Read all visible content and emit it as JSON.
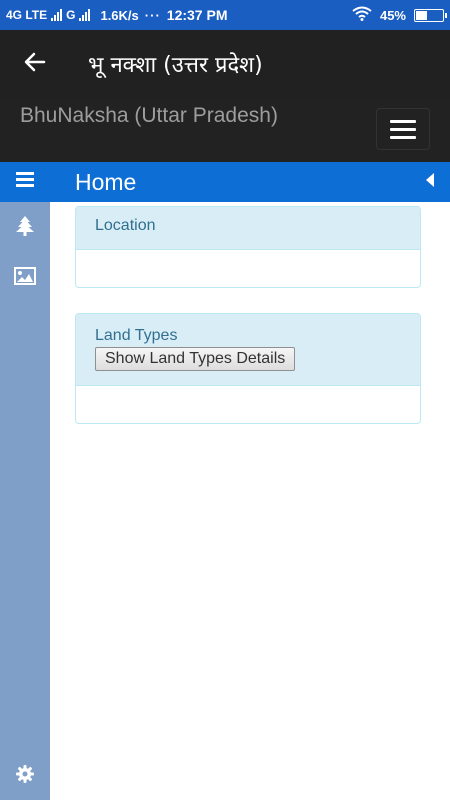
{
  "status_bar": {
    "network1": "4G LTE",
    "network2": "G",
    "data_speed": "1.6K/s",
    "dots": "···",
    "time": "12:37 PM",
    "battery": "45%",
    "battery_level": 0.45
  },
  "toolbar": {
    "title": "भू नक्शा (उत्तर प्रदेश)",
    "back_icon": "arrow-left-icon"
  },
  "header": {
    "brand": "BhuNaksha (Uttar Pradesh)",
    "menu_icon": "hamburger-icon"
  },
  "home_bar": {
    "title": "Home",
    "menu_icon": "hamburger-icon",
    "collapse_icon": "caret-left-icon"
  },
  "sidebar": {
    "icons": [
      "tree-icon",
      "image-icon",
      "gear-icon"
    ]
  },
  "panels": {
    "location": {
      "title": "Location"
    },
    "land_types": {
      "title": "Land Types",
      "button_label": "Show Land Types Details"
    }
  },
  "colors": {
    "status_bar": "#1b5ec2",
    "toolbar": "#212121",
    "header": "#222222",
    "home_bar": "#0d6fd6",
    "sidebar": "#7f9ec8",
    "panel_head": "#d9edf7",
    "panel_text": "#31708f"
  }
}
